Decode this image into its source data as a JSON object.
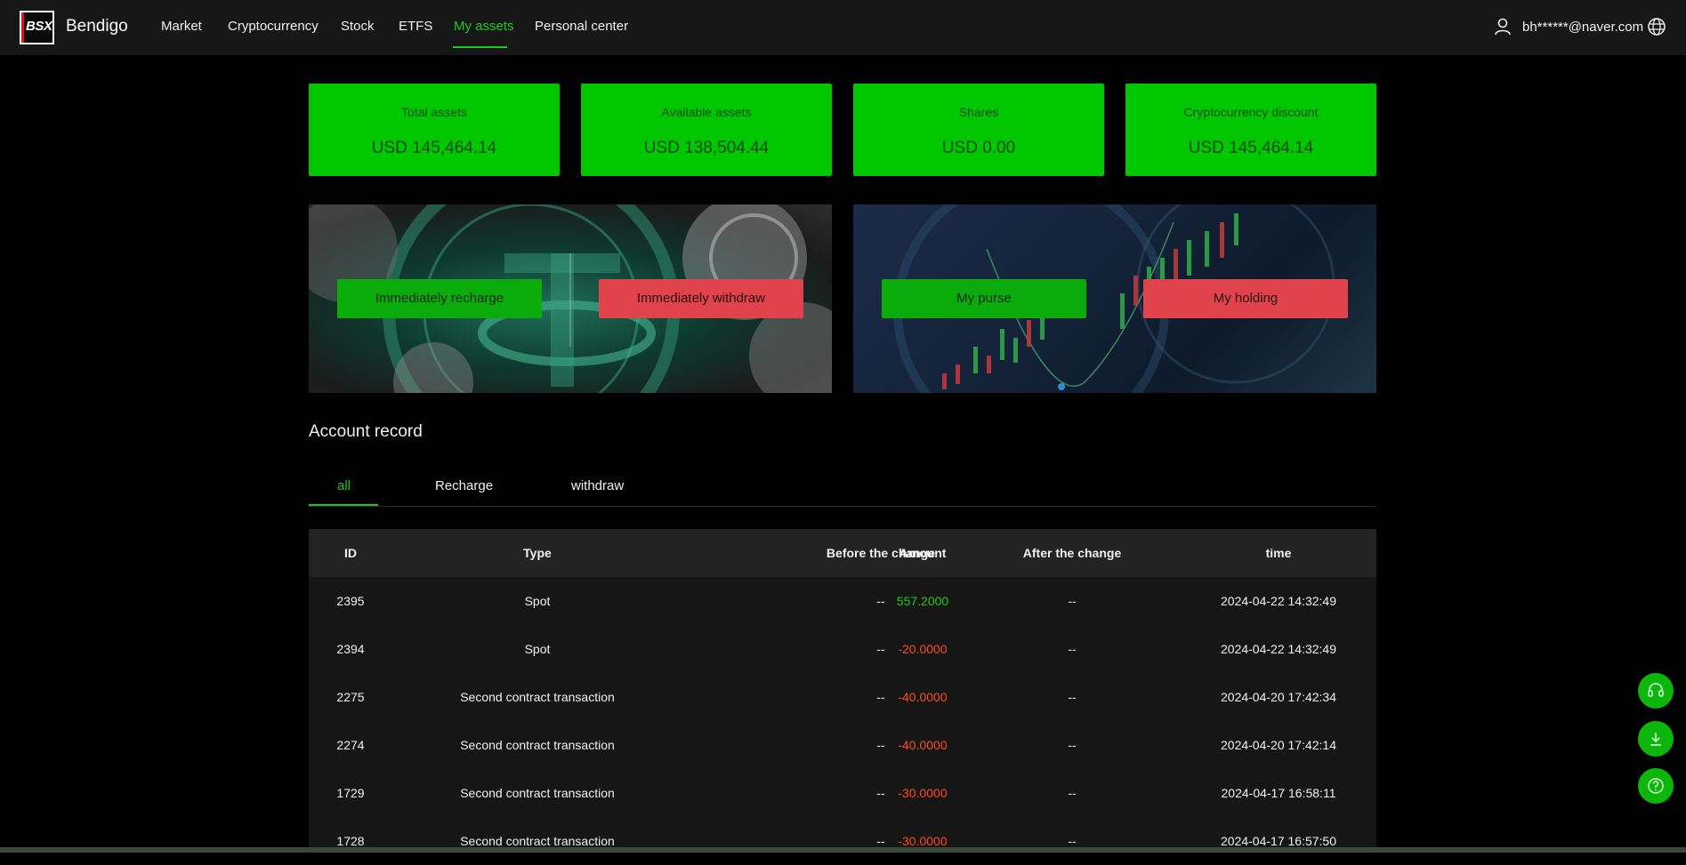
{
  "brand": {
    "logo_text": "BSX",
    "name": "Bendigo"
  },
  "nav": {
    "items": [
      {
        "label": "Market"
      },
      {
        "label": "Cryptocurrency"
      },
      {
        "label": "Stock"
      },
      {
        "label": "ETFS"
      },
      {
        "label": "My assets",
        "active": true
      },
      {
        "label": "Personal center"
      }
    ],
    "user_email": "bh******@naver.com",
    "user_icon": "user-icon",
    "language_icon": "globe-icon"
  },
  "stats": [
    {
      "label": "Total assets",
      "value": "USD 145,464.14"
    },
    {
      "label": "Available assets",
      "value": "USD 138,504.44"
    },
    {
      "label": "Shares",
      "value": "USD 0.00"
    },
    {
      "label": "Cryptocurrency discount",
      "value": "USD 145,464.14"
    }
  ],
  "banners": {
    "recharge": "Immediately recharge",
    "withdraw": "Immediately withdraw",
    "purse": "My purse",
    "holding": "My holding"
  },
  "record": {
    "title": "Account record",
    "tabs": [
      {
        "label": "all",
        "active": true
      },
      {
        "label": "Recharge"
      },
      {
        "label": "withdraw"
      }
    ],
    "columns": [
      "ID",
      "Type",
      "Amount",
      "Before the change",
      "After the change",
      "time"
    ],
    "rows": [
      {
        "id": "2395",
        "type": "Spot",
        "amount": "557.2000",
        "before": "--",
        "after": "--",
        "time": "2024-04-22 14:32:49"
      },
      {
        "id": "2394",
        "type": "Spot",
        "amount": "-20.0000",
        "before": "--",
        "after": "--",
        "time": "2024-04-22 14:32:49"
      },
      {
        "id": "2275",
        "type": "Second contract transaction",
        "amount": "-40.0000",
        "before": "--",
        "after": "--",
        "time": "2024-04-20 17:42:34"
      },
      {
        "id": "2274",
        "type": "Second contract transaction",
        "amount": "-40.0000",
        "before": "--",
        "after": "--",
        "time": "2024-04-20 17:42:14"
      },
      {
        "id": "1729",
        "type": "Second contract transaction",
        "amount": "-30.0000",
        "before": "--",
        "after": "--",
        "time": "2024-04-17 16:58:11"
      },
      {
        "id": "1728",
        "type": "Second contract transaction",
        "amount": "-30.0000",
        "before": "--",
        "after": "--",
        "time": "2024-04-17 16:57:50"
      }
    ]
  },
  "floating": {
    "support_icon": "headset-icon",
    "download_icon": "download-icon",
    "help_icon": "question-icon"
  },
  "colors": {
    "accent": "#1ec91e",
    "card": "#00c700",
    "negative": "#ff4a1f",
    "withdraw": "#e0434b"
  }
}
